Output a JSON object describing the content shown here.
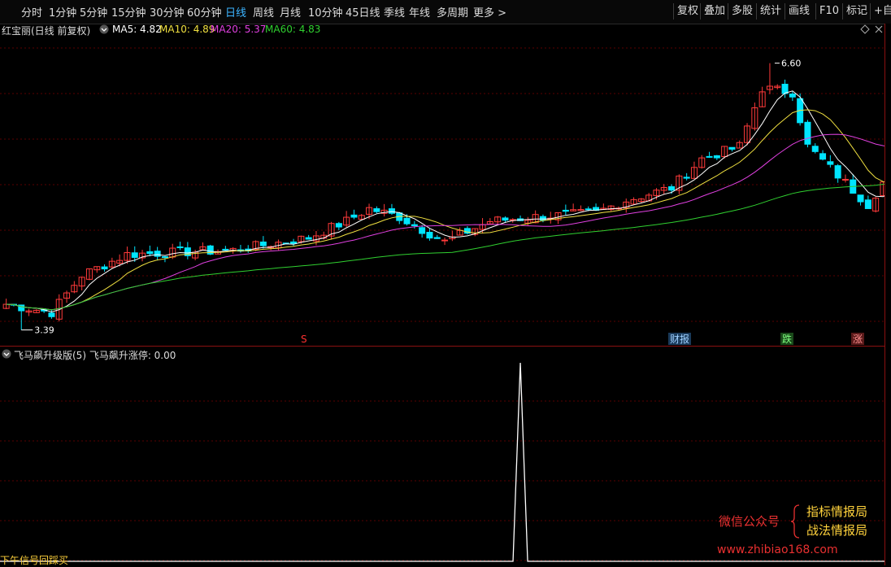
{
  "period_tabs": [
    "分时",
    "1分钟",
    "5分钟",
    "15分钟",
    "30分钟",
    "60分钟",
    "日线",
    "周线",
    "月线",
    "10分钟",
    "45日线",
    "季线",
    "年线",
    "多周期",
    "更多 >"
  ],
  "active_period": "日线",
  "toolbar": [
    "复权",
    "叠加",
    "多股",
    "统计",
    "画线",
    "F10",
    "标记",
    "+自选"
  ],
  "stock_title": "红宝丽(日线 前复权)",
  "ma_labels": {
    "ma5": "MA5: 4.82",
    "ma10": "MA10: 4.89",
    "ma20": "MA20: 5.37",
    "ma60": "MA60: 4.83"
  },
  "colors": {
    "up": "#ff3a3a",
    "down": "#00e5ff",
    "ma5": "#ffffff",
    "ma10": "#f0e040",
    "ma20": "#e040e0",
    "ma60": "#30d030",
    "bg": "#000000",
    "grid": "#5a0000",
    "accent": "#3cb4ff"
  },
  "price_annotations": {
    "high": "6.60",
    "low": "3.39"
  },
  "event_tags": {
    "s": "S",
    "caibao": "财报",
    "die": "跌",
    "zhang": "涨"
  },
  "indicator_label": "飞马飙升级版(5) 飞马飙升涨停: 0.00",
  "bottom_label": "下午信号回踩买",
  "watermark": {
    "left": "微信公众号",
    "right1": "指标情报局",
    "right2": "战法情报局",
    "url": "www.zhibiao168.com"
  },
  "icons": {
    "collapse": "chevron-down-icon",
    "diamond": "diamond-icon",
    "close": "close-icon"
  }
}
